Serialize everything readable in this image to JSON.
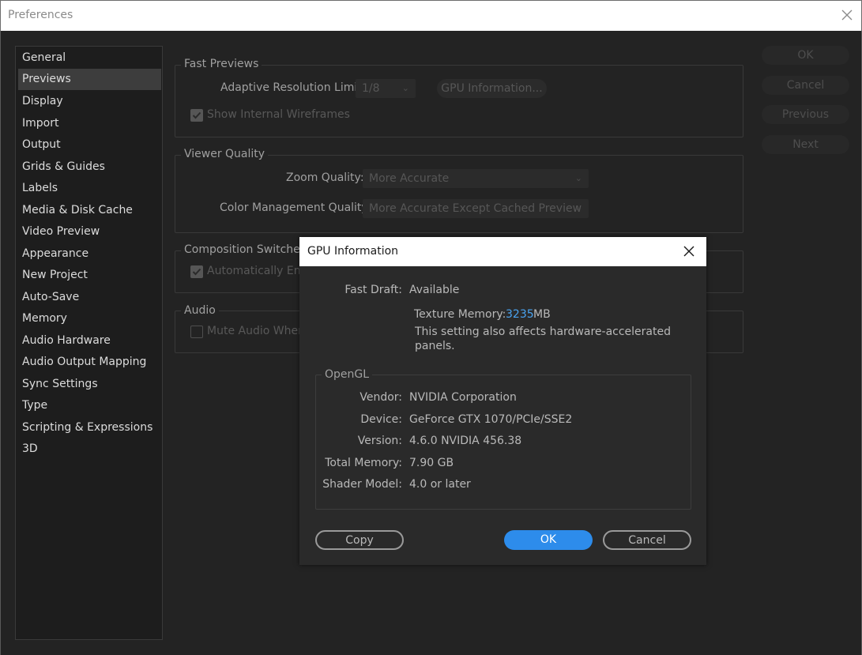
{
  "window": {
    "title": "Preferences"
  },
  "sidebar": {
    "items": [
      {
        "label": "General"
      },
      {
        "label": "Previews"
      },
      {
        "label": "Display"
      },
      {
        "label": "Import"
      },
      {
        "label": "Output"
      },
      {
        "label": "Grids & Guides"
      },
      {
        "label": "Labels"
      },
      {
        "label": "Media & Disk Cache"
      },
      {
        "label": "Video Preview"
      },
      {
        "label": "Appearance"
      },
      {
        "label": "New Project"
      },
      {
        "label": "Auto-Save"
      },
      {
        "label": "Memory"
      },
      {
        "label": "Audio Hardware"
      },
      {
        "label": "Audio Output Mapping"
      },
      {
        "label": "Sync Settings"
      },
      {
        "label": "Type"
      },
      {
        "label": "Scripting & Expressions"
      },
      {
        "label": "3D"
      }
    ],
    "selected": "Previews"
  },
  "fast_previews": {
    "title": "Fast Previews",
    "adaptive_label": "Adaptive Resolution Limit:",
    "adaptive_value": "1/8",
    "gpu_info_button": "GPU Information...",
    "wireframes_label": "Show Internal Wireframes",
    "wireframes_checked": true
  },
  "viewer_quality": {
    "title": "Viewer Quality",
    "zoom_label": "Zoom Quality:",
    "zoom_value": "More Accurate",
    "color_label": "Color Management Quality:",
    "color_value": "More Accurate Except Cached Preview"
  },
  "composition_switches": {
    "title": "Composition Switches",
    "auto_label": "Automatically Enab",
    "auto_checked": true
  },
  "audio": {
    "title": "Audio",
    "mute_label": "Mute Audio When",
    "mute_checked": false
  },
  "actions": {
    "ok": "OK",
    "cancel": "Cancel",
    "previous": "Previous",
    "next": "Next"
  },
  "gpu_dialog": {
    "title": "GPU Information",
    "fast_draft_label": "Fast Draft:",
    "fast_draft_value": "Available",
    "texture_label": "Texture Memory:",
    "texture_value": "3235",
    "texture_unit": "MB",
    "note_line1": "This setting also affects hardware-accelerated",
    "note_line2": "panels.",
    "opengl_title": "OpenGL",
    "vendor_label": "Vendor:",
    "vendor_value": "NVIDIA Corporation",
    "device_label": "Device:",
    "device_value": "GeForce GTX 1070/PCIe/SSE2",
    "version_label": "Version:",
    "version_value": "4.6.0 NVIDIA 456.38",
    "total_label": "Total Memory:",
    "total_value": "7.90 GB",
    "shader_label": "Shader Model:",
    "shader_value": "4.0 or later",
    "copy_button": "Copy",
    "ok_button": "OK",
    "cancel_button": "Cancel"
  },
  "colors": {
    "accent": "#2d8ceb",
    "texture_value": "#4aa3f0"
  }
}
